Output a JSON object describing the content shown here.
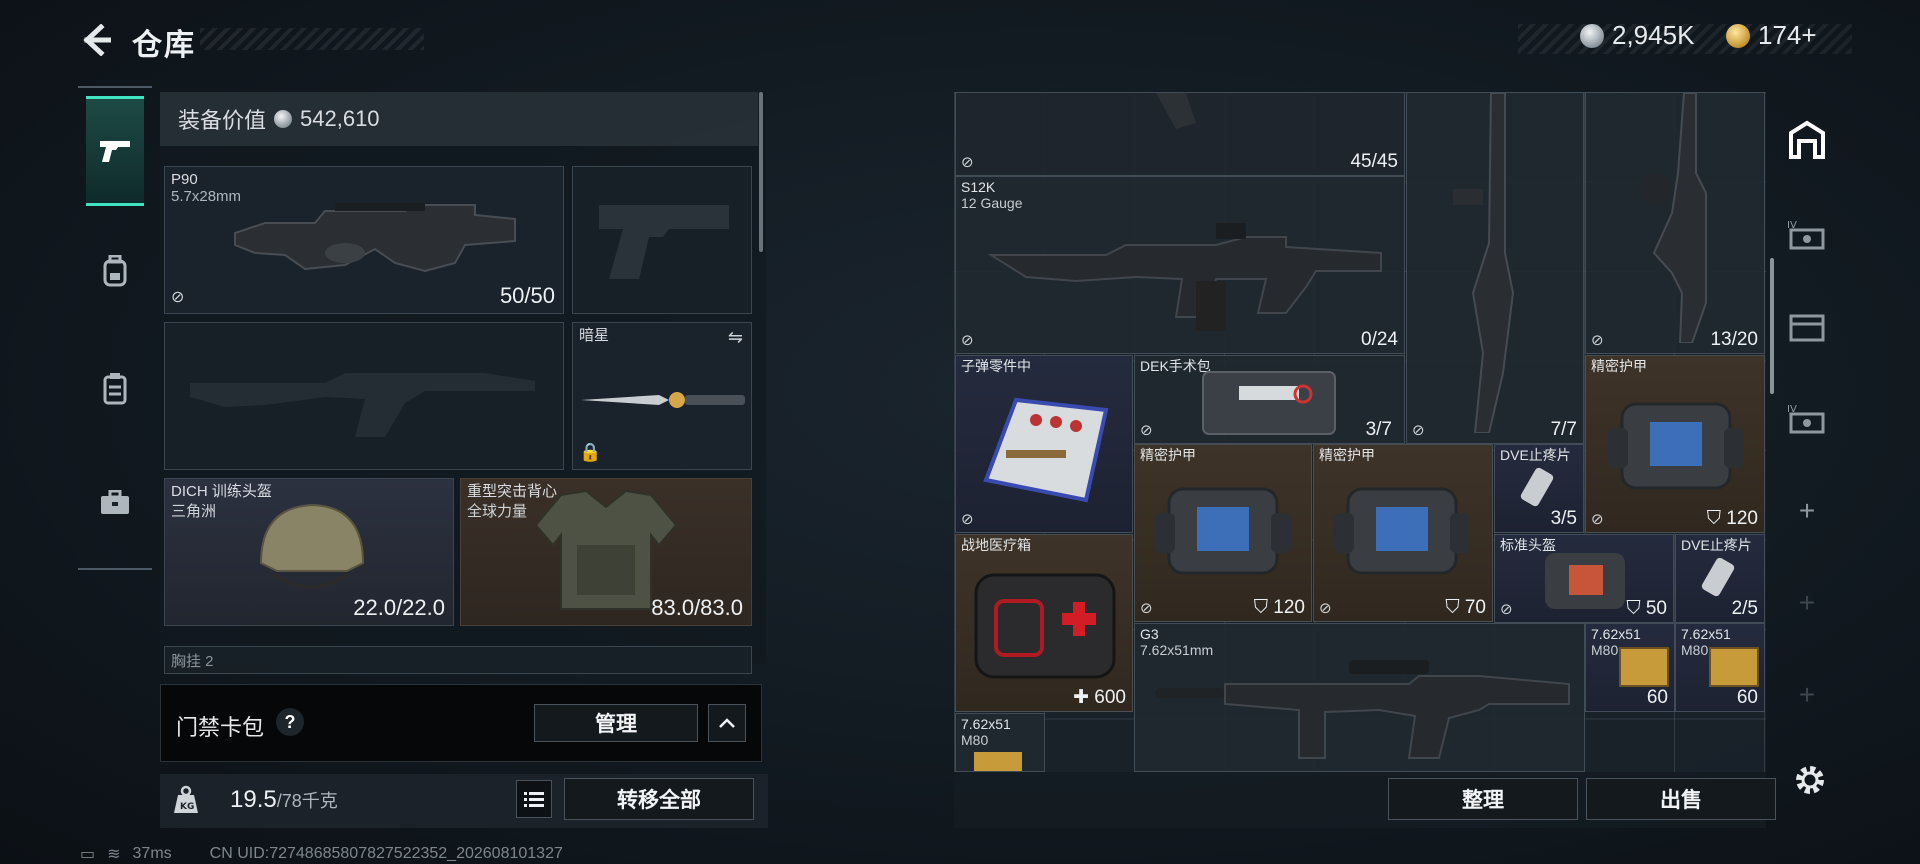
{
  "header": {
    "title": "仓库",
    "currency": [
      {
        "icon": "silver-coin-icon",
        "amount": "2,945K"
      },
      {
        "icon": "gold-coin-icon",
        "amount": "174+"
      }
    ]
  },
  "nav": {
    "items": [
      {
        "icon": "pistol-icon",
        "active": true
      },
      {
        "icon": "backpack-icon",
        "active": false
      },
      {
        "icon": "vest-icon",
        "active": false
      },
      {
        "icon": "briefcase-icon",
        "active": false
      }
    ]
  },
  "loadout": {
    "value_label": "装备价值",
    "value": "542,610",
    "primary": {
      "name": "P90",
      "caliber": "5.7x28mm",
      "ammo": "50/50"
    },
    "secondary_name": "",
    "melee": {
      "name": "暗星"
    },
    "helmet": {
      "name": "DICH 训练头盔",
      "sub": "三角洲",
      "durability": "22.0/22.0"
    },
    "armor": {
      "name": "重型突击背心",
      "sub": "全球力量",
      "durability": "83.0/83.0"
    },
    "chest_rig_partial": "胸挂 2"
  },
  "keycard": {
    "label": "门禁卡包",
    "help": "?",
    "manage_label": "管理",
    "chevron": "^"
  },
  "weight": {
    "current": "19.5",
    "max": "/78千克",
    "transfer_all": "转移全部"
  },
  "status": {
    "ping": "37ms",
    "uid": "CN UID:72748685807827522352_202608101327"
  },
  "storage": {
    "items": [
      {
        "id": "mag-top",
        "name": "",
        "value": "45/45"
      },
      {
        "id": "s12k",
        "name": "S12K",
        "sub": "12 Gauge",
        "value": "0/24"
      },
      {
        "id": "shotgun-vert",
        "name": "",
        "value": "7/7"
      },
      {
        "id": "rifle-vert",
        "name": "",
        "value": "13/20"
      },
      {
        "id": "ammo-parts",
        "name": "子弹零件中",
        "value": ""
      },
      {
        "id": "dek-kit",
        "name": "DEK手术包",
        "value": "3/7"
      },
      {
        "id": "precision-armor-1",
        "name": "精密护甲",
        "value": "120"
      },
      {
        "id": "precision-armor-2",
        "name": "精密护甲",
        "value": "120"
      },
      {
        "id": "precision-armor-3",
        "name": "精密护甲",
        "value": "70"
      },
      {
        "id": "dve-1",
        "name": "DVE止疼片",
        "value": "3/5"
      },
      {
        "id": "field-medkit",
        "name": "战地医疗箱",
        "value": "600"
      },
      {
        "id": "std-helmet",
        "name": "标准头盔",
        "value": "50"
      },
      {
        "id": "dve-2",
        "name": "DVE止疼片",
        "value": "2/5"
      },
      {
        "id": "g3",
        "name": "G3",
        "sub": "7.62x51mm",
        "value": ""
      },
      {
        "id": "ammo-1",
        "name": "7.62x51",
        "sub": "M80",
        "value": "60"
      },
      {
        "id": "ammo-2",
        "name": "7.62x51",
        "sub": "M80",
        "value": "60"
      },
      {
        "id": "ammo-3",
        "name": "7.62x51",
        "sub": "M80",
        "value": ""
      }
    ],
    "sort_label": "整理",
    "sell_label": "出售"
  }
}
